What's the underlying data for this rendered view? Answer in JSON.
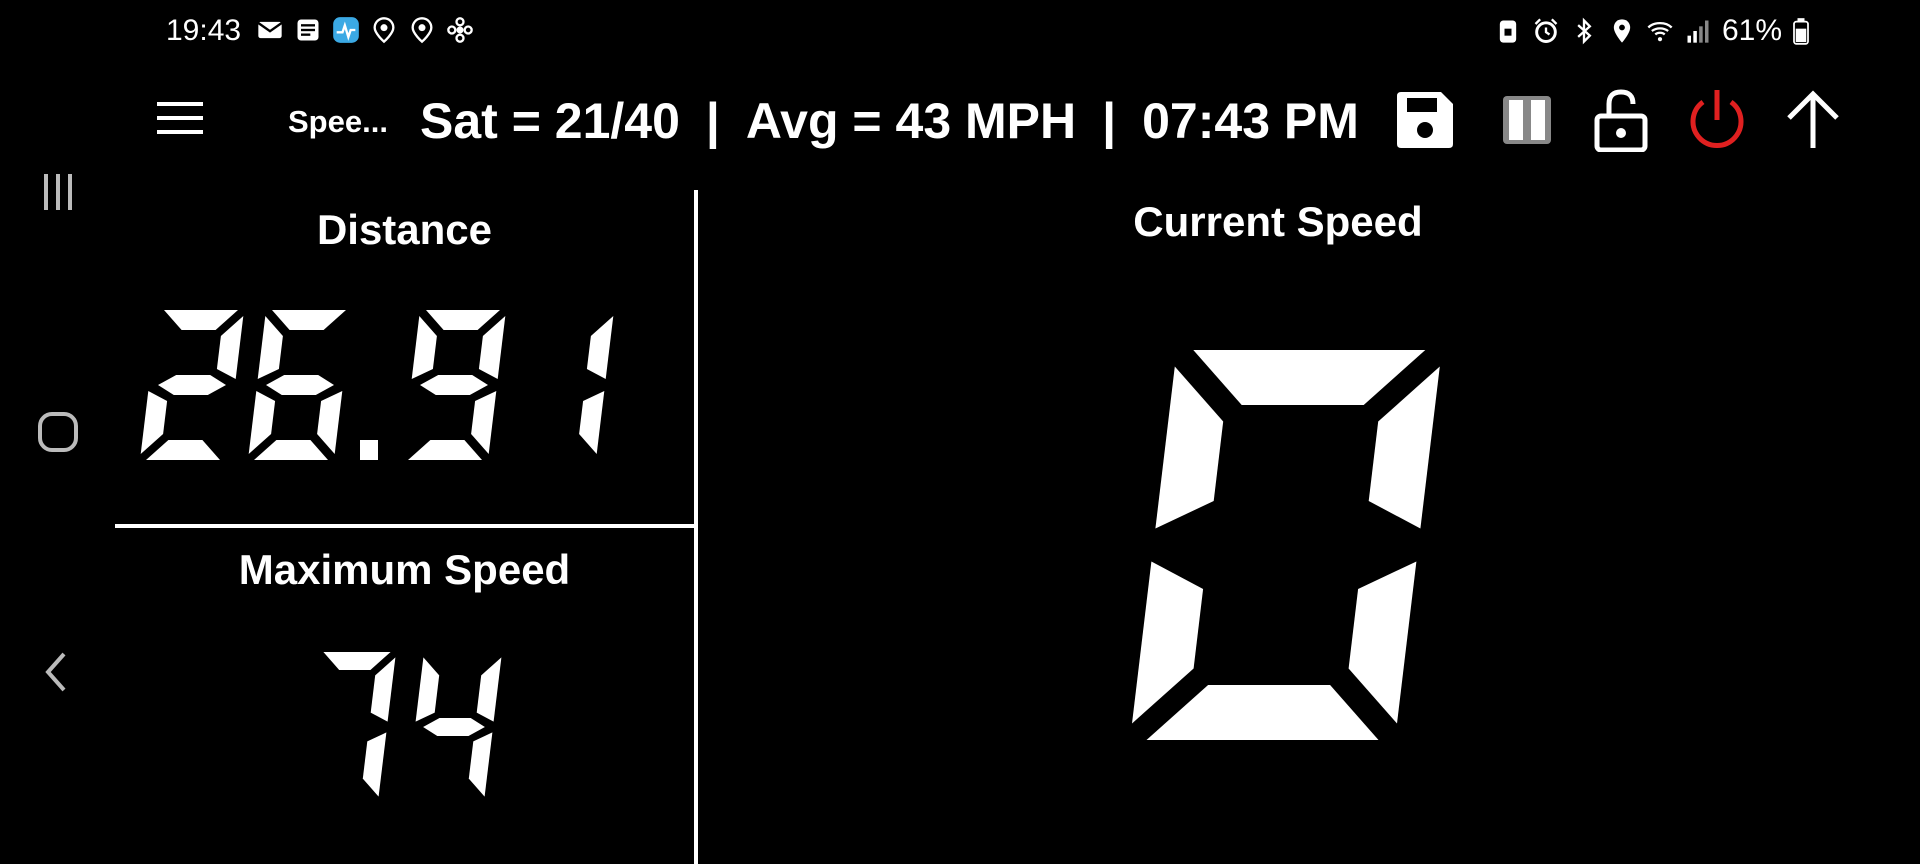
{
  "status_bar": {
    "time": "19:43",
    "battery": "61%",
    "left_icons": [
      "mail-icon",
      "news-icon",
      "app-icon",
      "location-pin-icon",
      "location-pin-icon",
      "fan-icon"
    ],
    "right_icons": [
      "lock-icon",
      "alarm-icon",
      "bluetooth-icon",
      "location-icon",
      "wifi-icon",
      "signal-icon",
      "battery-icon"
    ]
  },
  "toolbar": {
    "app_title": "Spee...",
    "sat": "Sat = 21/40",
    "avg": "Avg = 43 MPH",
    "clock": "07:43 PM",
    "separator": "|",
    "icons": [
      "menu-icon",
      "save-icon",
      "pause-icon",
      "lock-open-icon",
      "power-icon",
      "arrow-up-icon"
    ],
    "power_color": "#e02020"
  },
  "panels": {
    "distance": {
      "title": "Distance",
      "value": "26.91"
    },
    "max_speed": {
      "title": "Maximum Speed",
      "value": "74"
    },
    "current_speed": {
      "title": "Current Speed",
      "value": "0"
    }
  },
  "nav_rail": [
    "recents-icon",
    "home-icon",
    "back-icon"
  ]
}
